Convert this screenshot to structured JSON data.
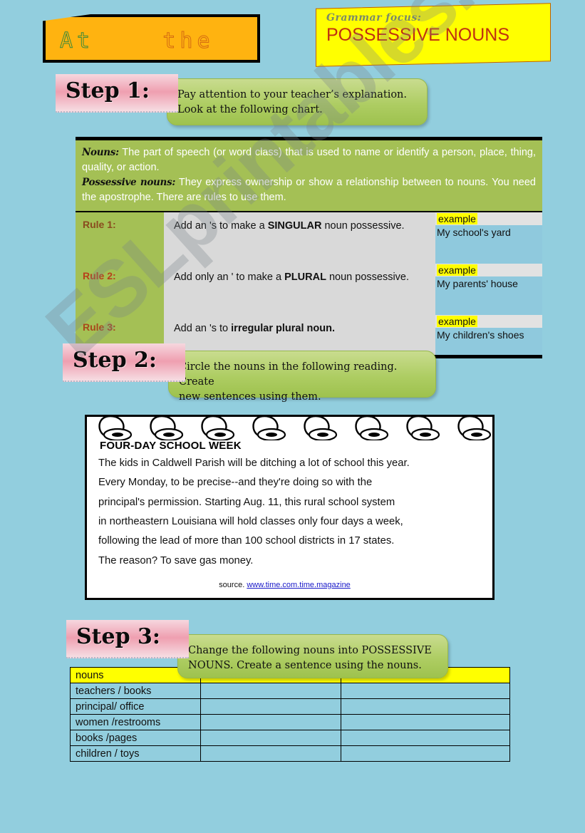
{
  "page": {
    "background_color": "#92cede",
    "watermark": "ESLprintables.com"
  },
  "title_box": {
    "part1": "At",
    "part2": "the",
    "background_color": "#ffb310"
  },
  "grammar_focus": {
    "label": "Grammar focus:",
    "title": "POSSESSIVE NOUNS",
    "background_color": "#ffff00",
    "title_color": "#c03010"
  },
  "steps": [
    {
      "label": "Step 1:",
      "instruction_line1": "Pay attention to your teacher’s explanation.",
      "instruction_line2": "Look at the following chart."
    },
    {
      "label": "Step 2:",
      "instruction_line1": "Circle the nouns in the following reading. Create",
      "instruction_line2": "new sentences using them."
    },
    {
      "label": "Step 3:",
      "instruction_line1": "Change the following nouns into POSSESSIVE",
      "instruction_line2": "NOUNS. Create a sentence using the nouns."
    }
  ],
  "chart": {
    "definitions": [
      {
        "term": "Nouns:",
        "text": "The part of speech (or word class) that is used to name or identify a person, place, thing, quality, or action."
      },
      {
        "term": "Possessive nouns:",
        "text": "They express ownership or show a relationship between to nouns. You need the apostrophe. There are rules to use them."
      }
    ],
    "example_label": "example",
    "rules": [
      {
        "name": "Rule 1:",
        "text_before": "Add an 's to make a ",
        "text_bold": "SINGULAR",
        "text_after": " noun possessive.",
        "example": "My school's yard"
      },
      {
        "name": "Rule 2:",
        "text_before": "Add only an ' to make a ",
        "text_bold": "PLURAL",
        "text_after": " noun possessive.",
        "example": "My parents' house"
      },
      {
        "name": "Rule 3:",
        "text_before": "Add an 's to ",
        "text_bold": "irregular plural noun.",
        "text_after": "",
        "example": "My children's shoes"
      }
    ]
  },
  "reading": {
    "headline": "FOUR-DAY SCHOOL WEEK",
    "lines": [
      "The kids in Caldwell Parish will be ditching a lot of school this year.",
      "Every Monday, to be precise--and they're doing so with the",
      " principal's permission. Starting Aug. 11, this rural school system",
      "in northeastern Louisiana will hold classes only four days a week,",
      "following the lead of more than 100 school districts in 17 states.",
      " The reason? To save gas money."
    ],
    "source_label": "source. ",
    "source_url": "www.time.com.time.magazine"
  },
  "nouns_table": {
    "header": "nouns",
    "rows": [
      "teachers / books",
      "principal/ office",
      "women /restrooms",
      "books /pages",
      "children / toys"
    ]
  }
}
